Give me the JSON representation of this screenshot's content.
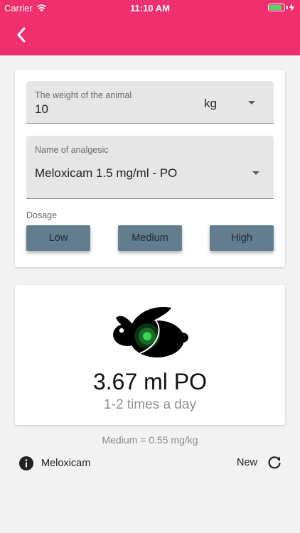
{
  "status_bar": {
    "carrier": "Carrier",
    "time": "11:10 AM",
    "battery_level": 0.85,
    "battery_color": "#4cd964"
  },
  "app_bar": {
    "color": "#f0306e",
    "back_icon": "chevron-left-icon"
  },
  "form": {
    "weight_label": "The weight of the animal",
    "weight_value": "10",
    "weight_unit": "kg",
    "analgesic_label": "Name of analgesic",
    "analgesic_value": "Meloxicam 1.5 mg/ml - PO",
    "dosage_label": "Dosage",
    "dosage_buttons": [
      "Low",
      "Medium",
      "High"
    ],
    "button_color": "#617d8e"
  },
  "result": {
    "icon": "rabbit-icon",
    "dose": "3.67 ml PO",
    "frequency": "1-2 times a day"
  },
  "dose_note": "Medium = 0.55 mg/kg",
  "footer": {
    "info_label": "Meloxicam",
    "info_icon": "info-icon",
    "new_label": "New",
    "new_icon": "refresh-icon"
  }
}
